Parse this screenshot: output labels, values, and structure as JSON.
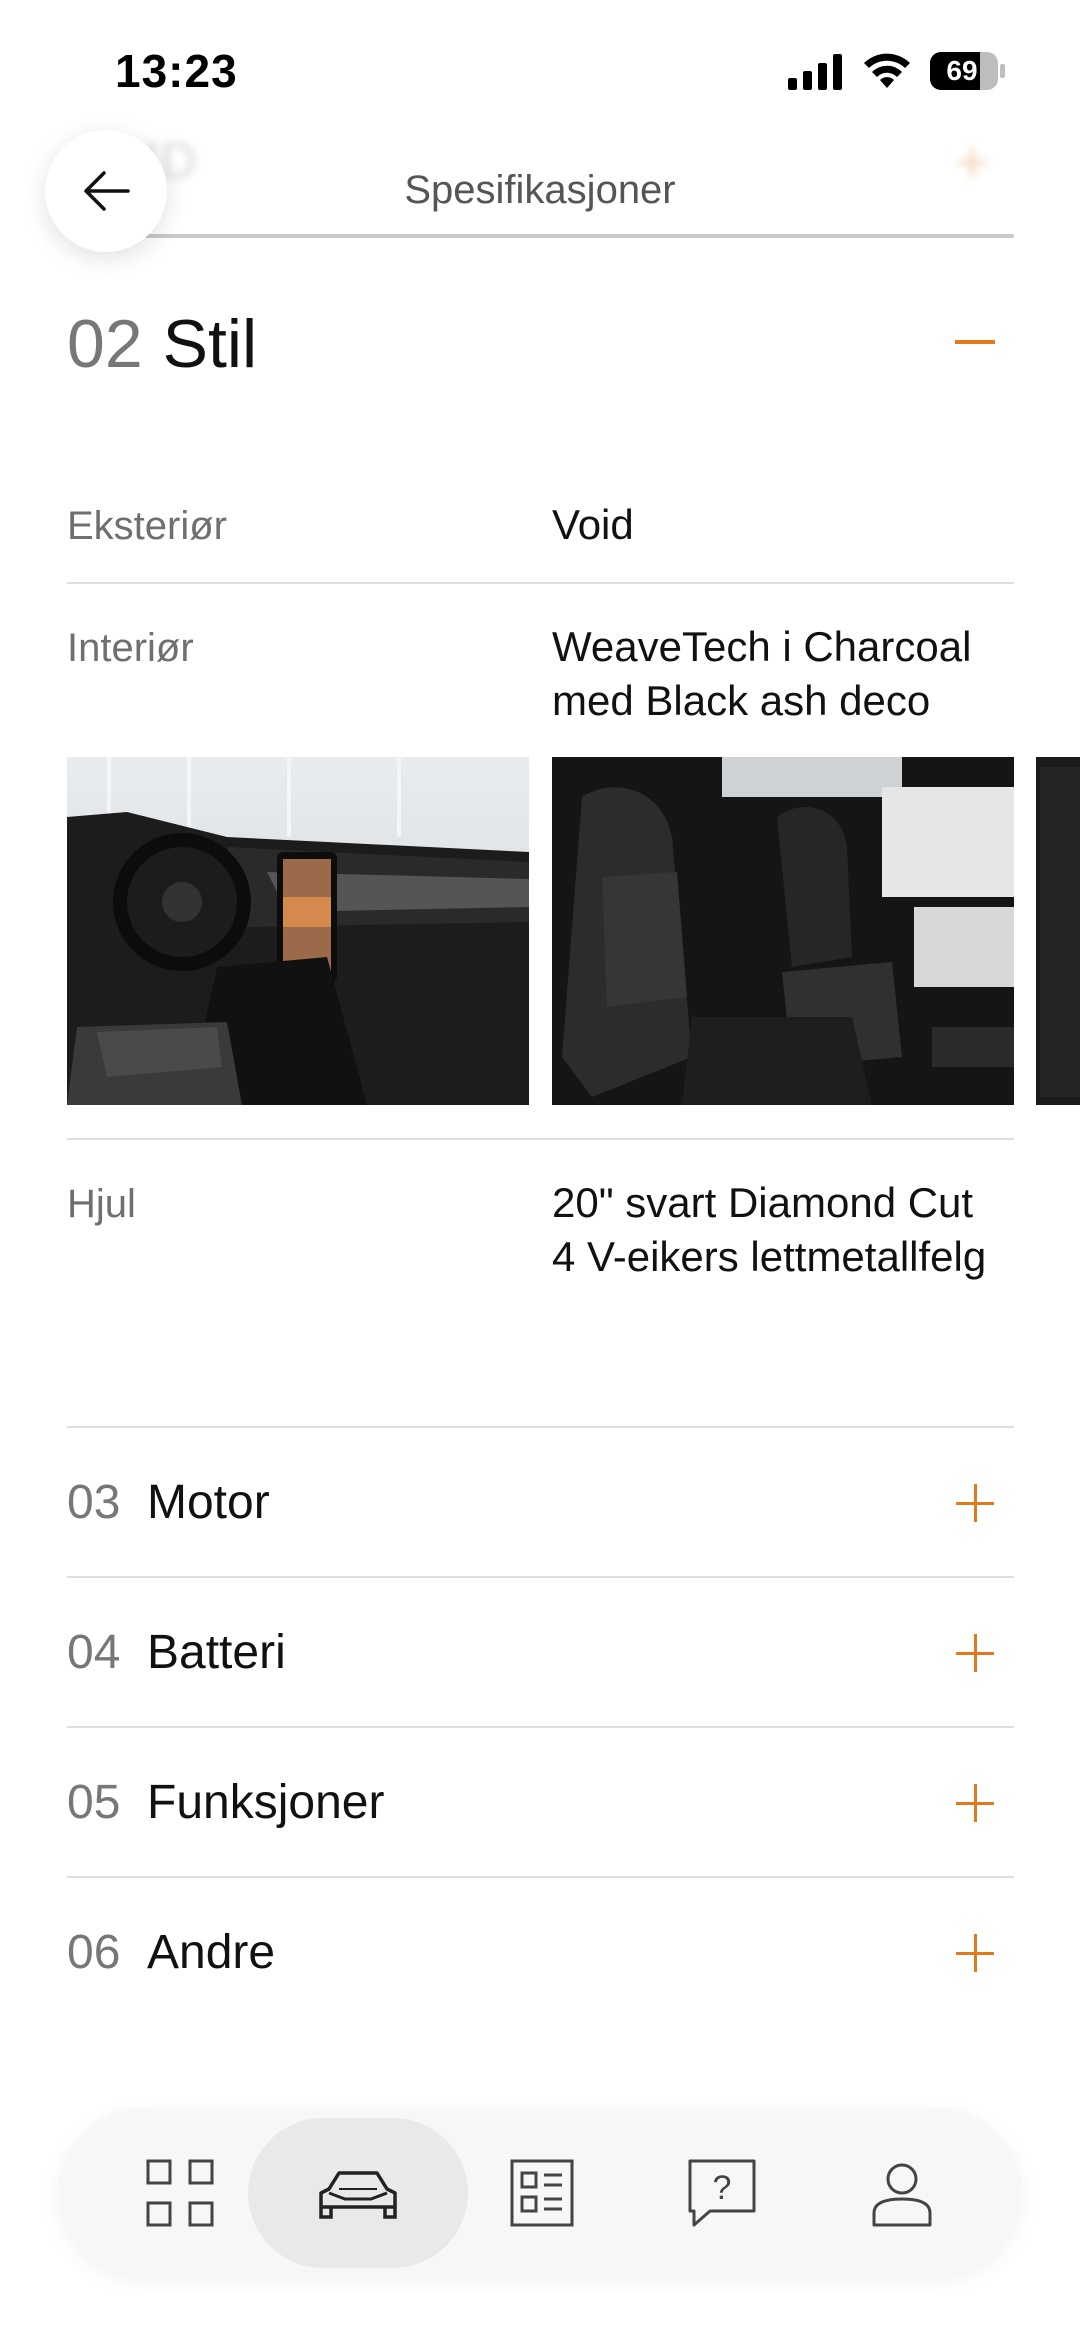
{
  "status_bar": {
    "time": "13:23",
    "battery": "69",
    "icons": [
      "signal-icon",
      "wifi-icon",
      "battery-icon"
    ]
  },
  "header": {
    "title": "Spesifikasjoner",
    "back_icon": "arrow-left-icon"
  },
  "section": {
    "number": "02",
    "name": "Stil",
    "toggle": "minus-icon",
    "rows": {
      "exterior": {
        "label": "Eksteriør",
        "value": "Void"
      },
      "interior": {
        "label": "Interiør",
        "value_line1": "WeaveTech i Charcoal",
        "value_line2": "med Black ash deco"
      },
      "wheels": {
        "label": "Hjul",
        "value_line1": "20\" svart Diamond Cut",
        "value_line2": "4 V-eikers lettmetallfelg"
      }
    },
    "images": [
      "interior-dashboard-image",
      "interior-seats-image",
      "interior-fabric-image"
    ]
  },
  "accordion": [
    {
      "number": "03",
      "name": "Motor"
    },
    {
      "number": "04",
      "name": "Batteri"
    },
    {
      "number": "05",
      "name": "Funksjoner"
    },
    {
      "number": "06",
      "name": "Andre"
    }
  ],
  "bottom_nav": {
    "items": [
      "grid-icon",
      "car-icon",
      "document-list-icon",
      "help-icon",
      "profile-icon"
    ],
    "active": "car-icon"
  },
  "colors": {
    "accent": "#e07a1c",
    "text": "#111111",
    "muted": "#6f6f6f",
    "divider": "#dedede"
  }
}
